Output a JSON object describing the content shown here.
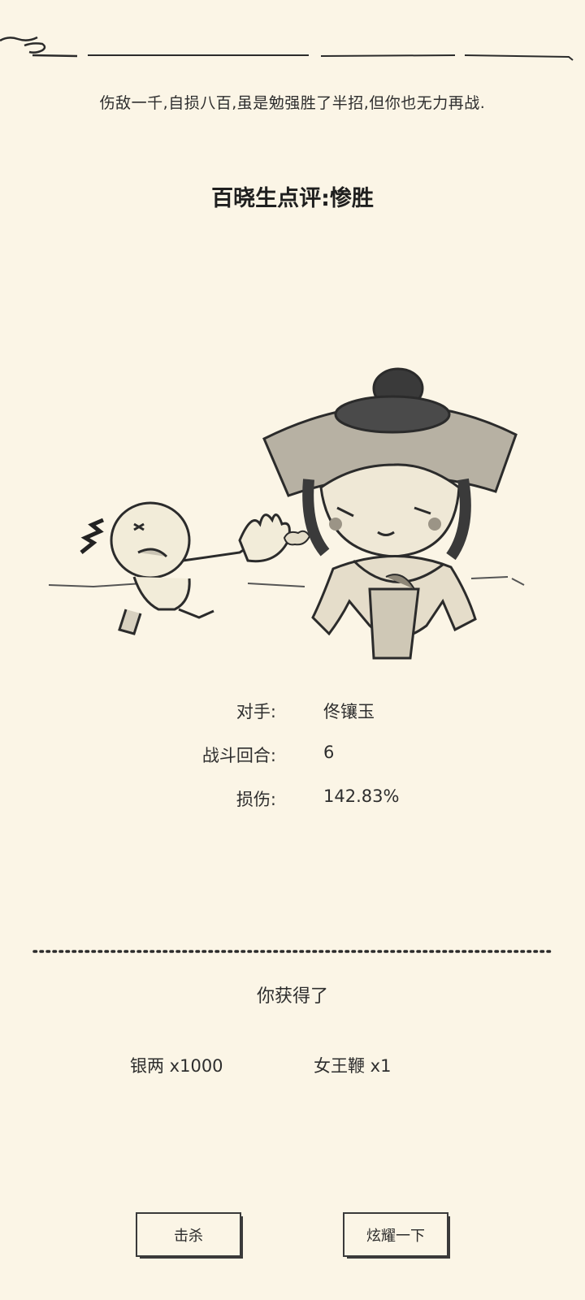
{
  "battle_result": {
    "description": "伤敌一千,自损八百,虽是勉强胜了半招,但你也无力再战.",
    "rating": "百晓生点评:惨胜"
  },
  "stats": {
    "opponent_label": "对手:",
    "opponent_value": "佟镶玉",
    "rounds_label": "战斗回合:",
    "rounds_value": "6",
    "damage_label": "损伤:",
    "damage_value": "142.83%"
  },
  "rewards": {
    "title": "你获得了",
    "items": [
      "银两 x1000",
      "女王鞭 x1"
    ]
  },
  "buttons": {
    "kill_label": "击杀",
    "show_off_label": "炫耀一下"
  },
  "colors": {
    "background": "#fbf5e6",
    "ink": "#2b2b2b"
  }
}
